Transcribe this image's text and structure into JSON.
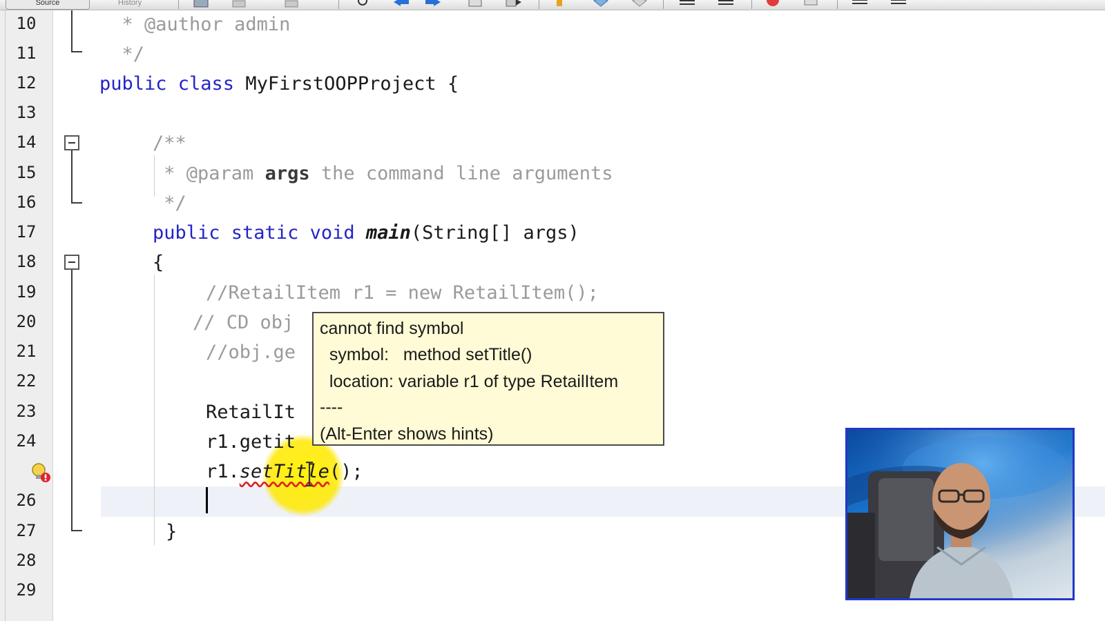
{
  "toolbar": {
    "source_tab": "Source",
    "history_tab": "History"
  },
  "line_numbers": [
    "10",
    "11",
    "12",
    "13",
    "14",
    "15",
    "16",
    "17",
    "18",
    "19",
    "20",
    "21",
    "22",
    "23",
    "24",
    "",
    "26",
    "27",
    "28",
    "29"
  ],
  "code": {
    "l10": "  * @author admin",
    "l11": "  */",
    "l12_kw": "public class",
    "l12_name": " MyFirstOOPProject {",
    "l14": "/**",
    "l15_a": " * ",
    "l15_param": "@param",
    "l15_args": "args",
    "l15_rest": " the command line arguments",
    "l16": " */",
    "l17_kw": "public static void",
    "l17_method": "main",
    "l17_rest": "(String[] args)",
    "l18": "{",
    "l19": "//RetailItem r1 = new RetailItem();",
    "l20": "// CD obj",
    "l21": "//obj.ge",
    "l23": "RetailIt",
    "l24": "r1.getit",
    "l25_a": "r1.",
    "l25_err": "setTitle",
    "l25_b": "();",
    "l27": "}"
  },
  "tooltip": {
    "line1": "cannot find symbol",
    "line2": "  symbol:   method setTitle()",
    "line3": "  location: variable r1 of type RetailItem",
    "line4": "----",
    "line5": "(Alt-Enter shows hints)"
  },
  "icons": {
    "error_badge": "lightbulb-error-icon",
    "fold": "fold-minus-icon",
    "cursor": "ibeam-cursor-icon"
  },
  "colors": {
    "keyword": "#2323c8",
    "comment": "#9a9a9a",
    "tooltip_bg": "#fffbd6",
    "error_underline": "#e02020"
  }
}
